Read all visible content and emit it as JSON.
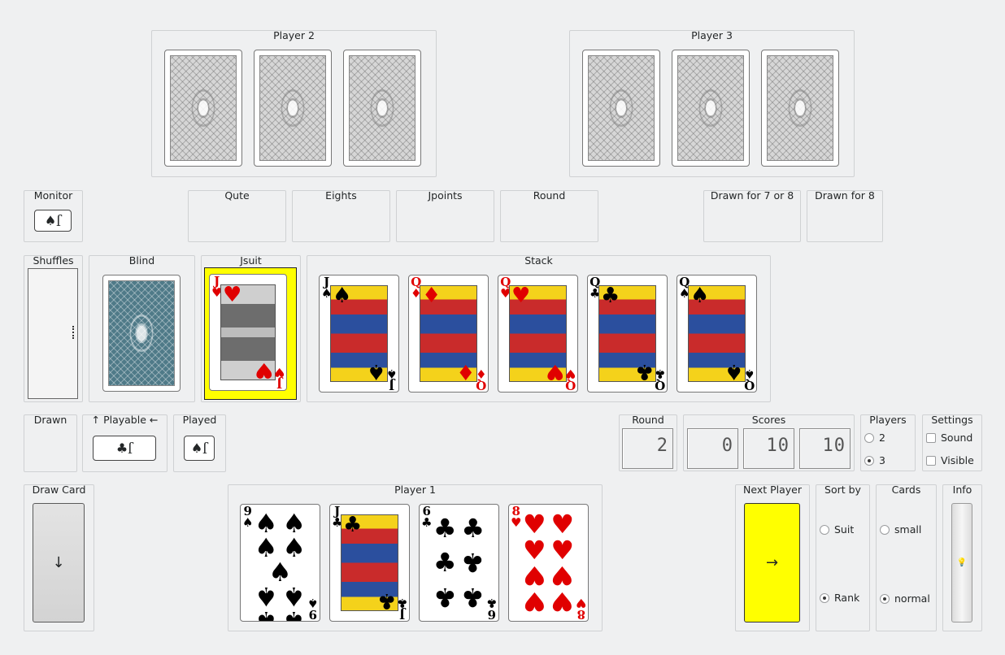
{
  "players": {
    "player2": "Player 2",
    "player3": "Player 3",
    "player1": "Player 1"
  },
  "monitor": {
    "title": "Monitor",
    "card_suit": "♠",
    "card_rank": "J"
  },
  "info_boxes": {
    "qute": "Qute",
    "eights": "Eights",
    "jpoints": "Jpoints",
    "round": "Round",
    "drawn78": "Drawn for 7 or 8",
    "drawn8": "Drawn for 8"
  },
  "shuffles": {
    "title": "Shuffles"
  },
  "blind": {
    "title": "Blind"
  },
  "jsuit": {
    "title": "Jsuit",
    "rank": "J",
    "suit": "♥"
  },
  "stack": {
    "title": "Stack",
    "cards": [
      {
        "rank": "J",
        "suit": "♠"
      },
      {
        "rank": "Q",
        "suit": "♦"
      },
      {
        "rank": "Q",
        "suit": "♥"
      },
      {
        "rank": "Q",
        "suit": "♣"
      },
      {
        "rank": "Q",
        "suit": "♠"
      }
    ]
  },
  "drawn": {
    "title": "Drawn"
  },
  "playable": {
    "title": "↑ Playable ←",
    "card_suit": "♣",
    "card_rank": "J"
  },
  "played": {
    "title": "Played",
    "card_suit": "♠",
    "card_rank": "J"
  },
  "round_panel": {
    "title": "Round",
    "value": "2"
  },
  "scores": {
    "title": "Scores",
    "values": [
      "0",
      "10",
      "10"
    ]
  },
  "players_panel": {
    "title": "Players",
    "options": [
      "2",
      "3"
    ],
    "selected": "3"
  },
  "settings": {
    "title": "Settings",
    "sound": "Sound",
    "visible": "Visible"
  },
  "draw_card": {
    "title": "Draw Card",
    "icon": "↓"
  },
  "hand": {
    "cards": [
      {
        "rank": "9",
        "suit": "♠"
      },
      {
        "rank": "J",
        "suit": "♣"
      },
      {
        "rank": "6",
        "suit": "♣"
      },
      {
        "rank": "8",
        "suit": "♥"
      }
    ]
  },
  "next_player": {
    "title": "Next Player",
    "icon": "→",
    "color": "#ffff00"
  },
  "sort_by": {
    "title": "Sort by",
    "options": [
      "Suit",
      "Rank"
    ],
    "selected": "Rank"
  },
  "cards_size": {
    "title": "Cards",
    "options": [
      "small",
      "normal"
    ],
    "selected": "normal"
  },
  "info": {
    "title": "Info",
    "icon": "💡"
  }
}
